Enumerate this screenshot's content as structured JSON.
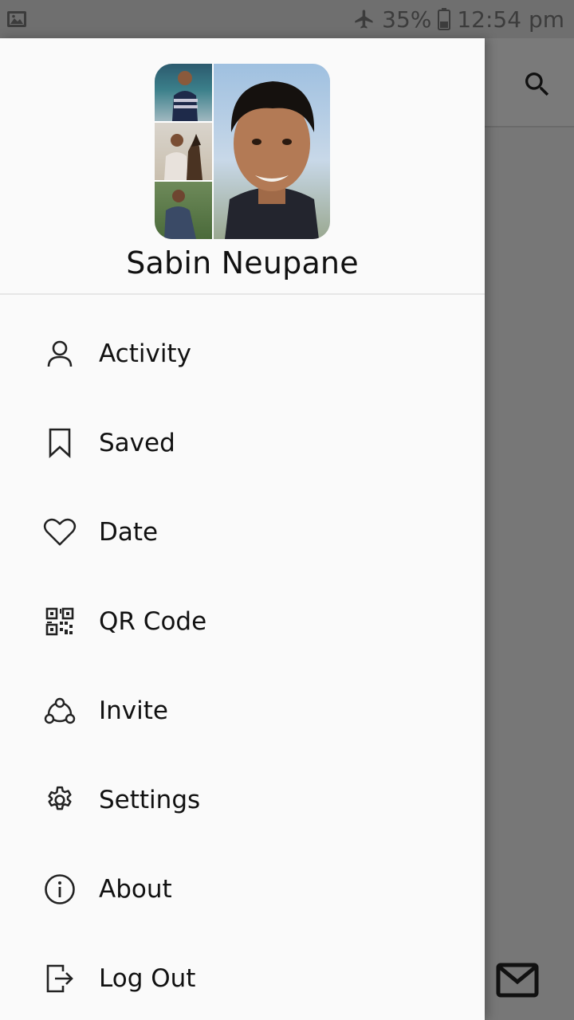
{
  "status_bar": {
    "left_icon": "gallery-notification-icon",
    "airplane_icon": "airplane-mode-icon",
    "battery_percent": "35%",
    "battery_icon": "battery-icon",
    "time": "12:54 pm"
  },
  "background": {
    "search_icon": "search-icon",
    "mail_icon": "mail-icon"
  },
  "drawer": {
    "user_name": "Sabin Neupane",
    "avatar_icon": "profile-photo-collage",
    "menu": [
      {
        "label": "Activity",
        "icon": "person-icon"
      },
      {
        "label": "Saved",
        "icon": "bookmark-icon"
      },
      {
        "label": "Date",
        "icon": "heart-icon"
      },
      {
        "label": "QR Code",
        "icon": "qr-code-icon"
      },
      {
        "label": "Invite",
        "icon": "share-network-icon"
      },
      {
        "label": "Settings",
        "icon": "gear-icon"
      },
      {
        "label": "About",
        "icon": "info-icon"
      },
      {
        "label": "Log Out",
        "icon": "logout-icon"
      }
    ]
  }
}
